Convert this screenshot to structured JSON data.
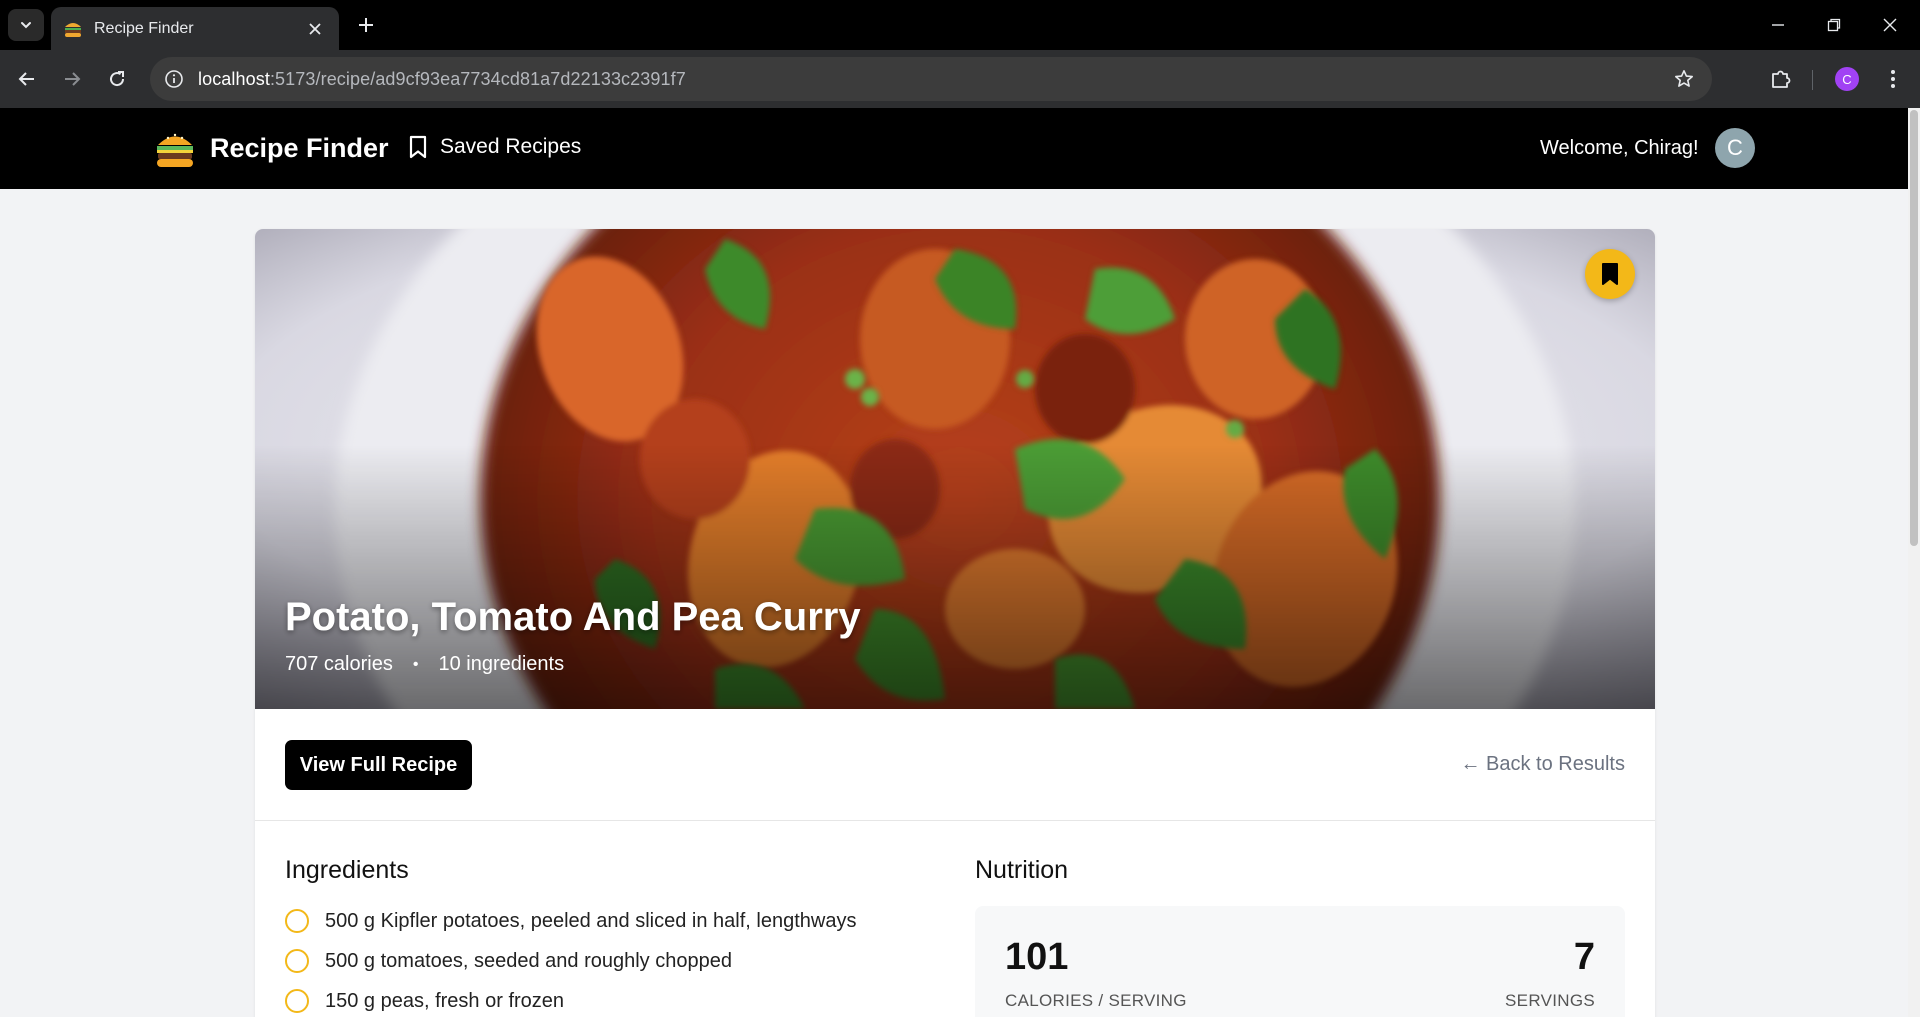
{
  "browser": {
    "tab_title": "Recipe Finder",
    "url_host": "localhost",
    "url_path": ":5173/recipe/ad9cf93ea7734cd81a7d22133c2391f7",
    "profile_initial": "C"
  },
  "header": {
    "brand_name": "Recipe Finder",
    "saved_recipes_label": "Saved Recipes",
    "welcome_text": "Welcome, Chirag!",
    "avatar_initial": "C"
  },
  "recipe": {
    "title": "Potato, Tomato And Pea Curry",
    "calories_text": "707 calories",
    "separator": "•",
    "ingredients_count_text": "10 ingredients",
    "view_full_recipe_label": "View Full Recipe",
    "back_link_label": "← Back to Results"
  },
  "ingredients": {
    "heading": "Ingredients",
    "items": [
      "500 g Kipfler potatoes, peeled and sliced in half, lengthways",
      "500 g tomatoes, seeded and roughly chopped",
      "150 g peas, fresh or frozen"
    ]
  },
  "nutrition": {
    "heading": "Nutrition",
    "calories_value": "101",
    "calories_label": "CALORIES / SERVING",
    "servings_value": "7",
    "servings_label": "SERVINGS"
  },
  "colors": {
    "accent": "#f3b818",
    "header_bg": "#000000",
    "page_bg": "#f2f3f5"
  }
}
